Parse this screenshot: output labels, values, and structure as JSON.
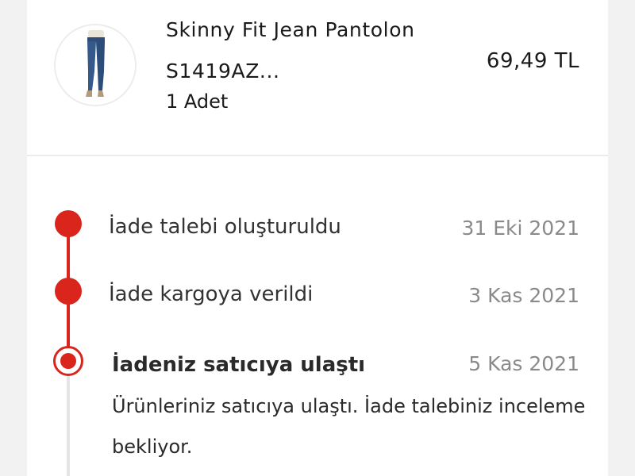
{
  "product": {
    "name": "Skinny Fit Jean Pantolon S1419AZ...",
    "quantity": "1 Adet",
    "price": "69,49 TL",
    "image_icon": "jeans-product-image"
  },
  "timeline": {
    "accent_color": "#d9251c",
    "steps": [
      {
        "label": "İade talebi oluşturuldu",
        "date": "31 Eki 2021",
        "status": "done"
      },
      {
        "label": "İade kargoya verildi",
        "date": "3 Kas 2021",
        "status": "done"
      },
      {
        "label": "İadeniz satıcıya ulaştı",
        "date": "5 Kas 2021",
        "status": "current",
        "description": "Ürünleriniz satıcıya ulaştı. İade talebiniz inceleme bekliyor."
      }
    ]
  }
}
